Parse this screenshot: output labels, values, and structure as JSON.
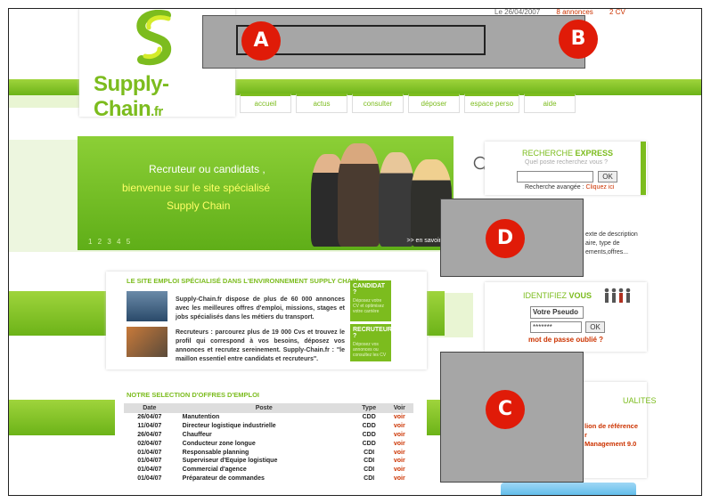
{
  "top_bar": {
    "date": "Le 26/04/2007",
    "annonces": "8 annonces",
    "cv": "2 CV"
  },
  "logo": {
    "name": "Supply-Chain",
    "tld": ".fr"
  },
  "nav": {
    "items": [
      "accueil",
      "actus",
      "consulter",
      "déposer",
      "espace perso",
      "aide"
    ]
  },
  "badges": {
    "a": "A",
    "b": "B",
    "c": "C",
    "d": "D"
  },
  "hero": {
    "line1": "Recruteur ou candidats ,",
    "line2": "bienvenue sur le site spécialisé",
    "line3": "Supply Chain",
    "pages": "1 2 3 4 5",
    "more": ">> en savoir +"
  },
  "recherche": {
    "title_part1": "RECHERCHE ",
    "title_part2": "EXPRESS",
    "subtitle": "Quel poste recherchez vous ?",
    "ok": "OK",
    "avancee_label": "Recherche avangée :",
    "avancee_link": "Cliquez ici"
  },
  "description": {
    "l1": "exte de description",
    "l2": "aire, type de",
    "l3": "ements,offres..."
  },
  "identification": {
    "title_part1": "IDENTIFIEZ ",
    "title_part2": "VOUS",
    "pseudo": "Votre Pseudo",
    "password": "*******",
    "ok": "OK",
    "forgot": "mot de passe oublié ?"
  },
  "actualites": {
    "title": "UALITES",
    "l1": "lion de référence",
    "l2": "r",
    "l3": "Management 9.0"
  },
  "site_emploi": {
    "title": "LE SITE EMPLOI SPÉCIALISÉ DANS L'ENVIRONNEMENT SUPPLY CHAIN",
    "p1": "Supply-Chain.fr dispose de plus de 60 000 annonces avec les meilleures offres d'emploi, missions, stages et jobs spécialisés dans les métiers du transport.",
    "p2": "Recruteurs : parcourez plus de 19 000 Cvs et trouvez le profil qui correspond à vos besoins, déposez vos annonces et recrutez sereinement. Supply-Chain.fr : \"le maillon essentiel entre candidats et recruteurs\".",
    "candidat_title": "CANDIDAT ?",
    "candidat_sub": "Déposez votre CV et optimisez votre carrière",
    "recruteur_title": "RECRUTEUR ?",
    "recruteur_sub": "Déposez vos annonces ou consultez les CV"
  },
  "offers": {
    "title": "NOTRE SELECTION D'OFFRES D'EMPLOI",
    "headers": [
      "Date",
      "Poste",
      "Type",
      "Voir"
    ],
    "rows": [
      [
        "26/04/07",
        "Manutention",
        "CDD",
        "voir"
      ],
      [
        "11/04/07",
        "Directeur logistique industrielle",
        "CDD",
        "voir"
      ],
      [
        "26/04/07",
        "Chauffeur",
        "CDD",
        "voir"
      ],
      [
        "02/04/07",
        "Conducteur zone longue",
        "CDD",
        "voir"
      ],
      [
        "01/04/07",
        "Responsable planning",
        "CDI",
        "voir"
      ],
      [
        "01/04/07",
        "Superviseur d'Equipe logistique",
        "CDI",
        "voir"
      ],
      [
        "01/04/07",
        "Commercial d'agence",
        "CDI",
        "voir"
      ],
      [
        "01/04/07",
        "Préparateur de commandes",
        "CDI",
        "voir"
      ]
    ]
  },
  "colors": {
    "green": "#7cbc1e",
    "red_badge": "#e01b08",
    "link_red": "#cc3300",
    "gray_mask": "#a6a6a6"
  }
}
